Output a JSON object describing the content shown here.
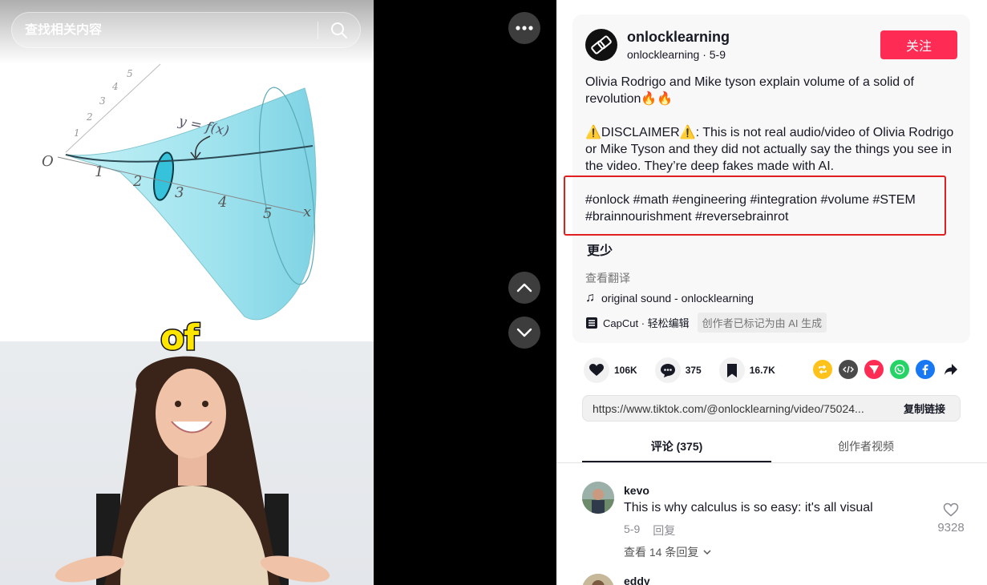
{
  "search": {
    "placeholder": "查找相关内容"
  },
  "video": {
    "caption_word": "of",
    "graph_labels": {
      "function_label": "y = f(x)",
      "origin": "O",
      "x_axis": "x",
      "ticks": [
        "1",
        "2",
        "3",
        "4",
        "5"
      ]
    }
  },
  "author": {
    "name": "onlocklearning",
    "handle": "onlocklearning",
    "date": "5-9",
    "follow_label": "关注"
  },
  "description": {
    "title": "Olivia Rodrigo and Mike tyson explain volume of a solid of revolution",
    "flames": "🔥🔥",
    "disclaimer_label": "DISCLAIMER",
    "disclaimer_text": ": This is not real audio/video of Olivia Rodrigo or Mike Tyson and they did not actually say the things you see in the video. They’re deep fakes made with AI.",
    "hashtags": "#onlock #math #engineering #integration #volume #STEM #brainnourishment #reversebrainrot",
    "less_label": "更少",
    "translate_label": "查看翻译",
    "sound": "original sound - onlocklearning",
    "capcut": "CapCut · 轻松编辑",
    "ai_badge": "创作者已标记为由 AI 生成"
  },
  "stats": {
    "likes": "106K",
    "comments": "375",
    "saves": "16.7K"
  },
  "share": {
    "link": "https://www.tiktok.com/@onlocklearning/video/75024...",
    "copy_label": "复制链接"
  },
  "tabs": {
    "comments": "评论 (375)",
    "creator_videos": "创作者视频"
  },
  "comments": [
    {
      "user": "kevo",
      "text": "This is why calculus is so easy: it's all visual",
      "date": "5-9",
      "reply_label": "回复",
      "likes": "9328",
      "view_replies": "查看 14 条回复"
    },
    {
      "user": "eddy"
    }
  ],
  "colors": {
    "accent": "#fe2c55",
    "highlight_box": "#e02020",
    "surface_teal": "#9fe3ee"
  }
}
